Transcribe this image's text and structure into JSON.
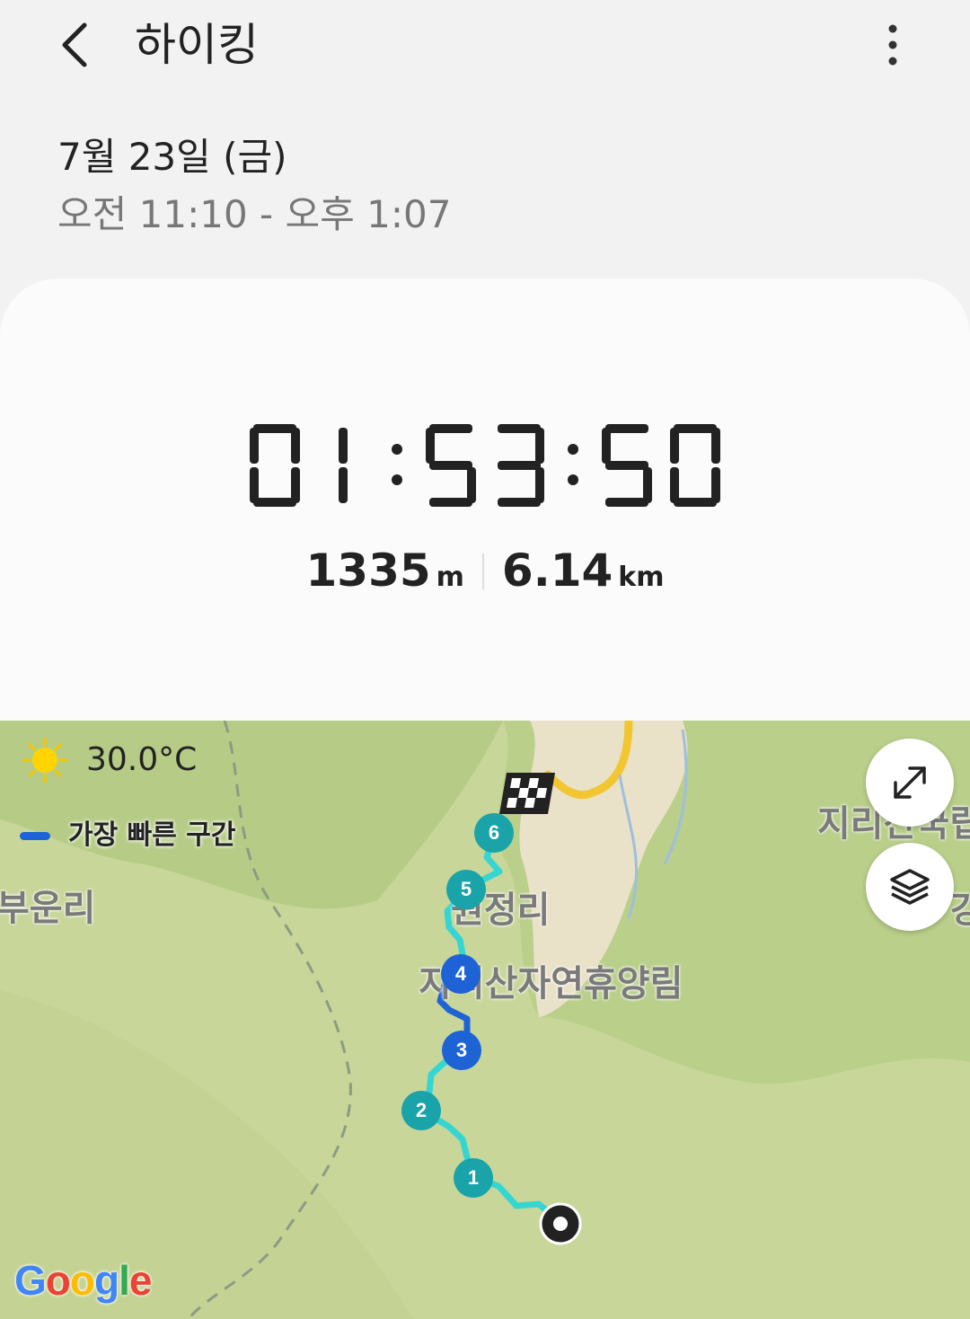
{
  "app": {
    "title": "하이킹"
  },
  "session": {
    "date": "7월 23일 (금)",
    "time_range": "오전 11:10 - 오후 1:07"
  },
  "summary": {
    "duration": "01:53:50",
    "elevation_value": "1335",
    "elevation_unit": "m",
    "distance_value": "6.14",
    "distance_unit": "km"
  },
  "map": {
    "weather_icon": "sun-icon",
    "temperature": "30.0°C",
    "legend_label": "가장 빠른 구간",
    "legend_color": "#1e63d6",
    "route_color": "#35d6d2",
    "place_labels": {
      "left_village": "부운리",
      "village": "원정리",
      "forest": "지리산자연휴양림",
      "park": "지리산국립",
      "edge": "강"
    },
    "markers": [
      {
        "number": "1",
        "color": "#1aa3a8"
      },
      {
        "number": "2",
        "color": "#1aa3a8"
      },
      {
        "number": "3",
        "color": "#1e63d6"
      },
      {
        "number": "4",
        "color": "#1e63d6"
      },
      {
        "number": "5",
        "color": "#1aa3a8"
      },
      {
        "number": "6",
        "color": "#1aa3a8"
      }
    ],
    "attribution": {
      "letters": [
        "G",
        "o",
        "o",
        "g",
        "l",
        "e"
      ]
    }
  },
  "icons": {
    "back": "back-arrow-icon",
    "more": "more-vertical-icon",
    "expand": "expand-icon",
    "layers": "layers-icon",
    "finish": "checkered-flag-icon",
    "start": "start-point-icon"
  }
}
